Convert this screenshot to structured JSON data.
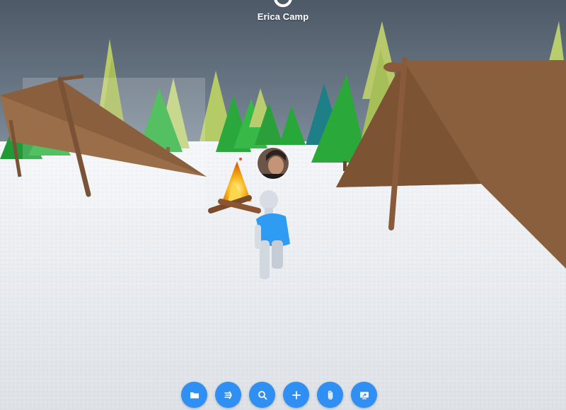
{
  "room": {
    "name": "Erica Camp"
  },
  "toolbar": {
    "buttons": [
      {
        "id": "folder",
        "icon": "folder-icon"
      },
      {
        "id": "speed",
        "icon": "move-speed-icon"
      },
      {
        "id": "search",
        "icon": "search-icon"
      },
      {
        "id": "add",
        "icon": "plus-icon"
      },
      {
        "id": "attach",
        "icon": "paperclip-icon"
      },
      {
        "id": "share-screen",
        "icon": "screen-share-icon"
      }
    ]
  },
  "colors": {
    "accent": "#2f8ff3",
    "sky": "#5a6775",
    "snow": "#eef0f3",
    "tent": "#8b5e3c",
    "shirt": "#2e9cf2"
  }
}
